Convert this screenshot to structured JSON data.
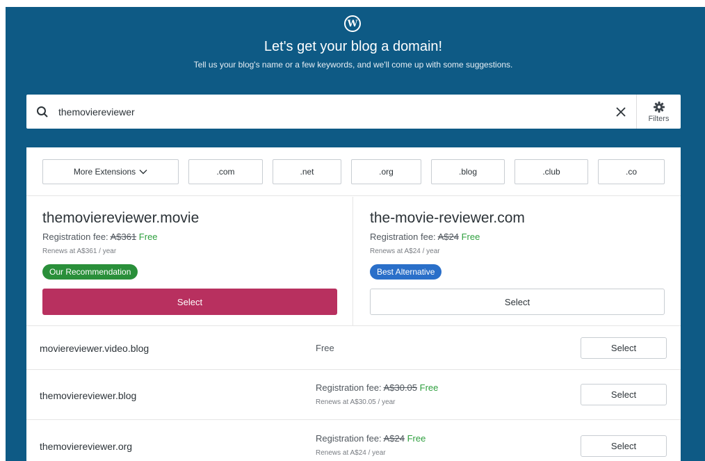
{
  "header": {
    "logo": "W",
    "title": "Let's get your blog a domain!",
    "subtitle": "Tell us your blog's name or a few keywords, and we'll come up with some suggestions."
  },
  "search": {
    "value": "themoviereviewer",
    "filters_label": "Filters"
  },
  "extensions": {
    "more_label": "More Extensions",
    "items": [
      ".com",
      ".net",
      ".org",
      ".blog",
      ".club",
      ".co"
    ]
  },
  "featured": [
    {
      "domain": "themoviereviewer.movie",
      "fee_label": "Registration fee:",
      "old_price": "A$361",
      "price": "Free",
      "renew": "Renews at A$361 / year",
      "badge": "Our Recommendation",
      "select_label": "Select"
    },
    {
      "domain": "the-movie-reviewer.com",
      "fee_label": "Registration fee:",
      "old_price": "A$24",
      "price": "Free",
      "renew": "Renews at A$24 / year",
      "badge": "Best Alternative",
      "select_label": "Select"
    }
  ],
  "results": [
    {
      "domain": "moviereviewer.video.blog",
      "price": "Free",
      "select_label": "Select"
    },
    {
      "domain": "themoviereviewer.blog",
      "fee_label": "Registration fee:",
      "old_price": "A$30.05",
      "price": "Free",
      "renew": "Renews at A$30.05 / year",
      "select_label": "Select"
    },
    {
      "domain": "themoviereviewer.org",
      "fee_label": "Registration fee:",
      "old_price": "A$24",
      "price": "Free",
      "renew": "Renews at A$24 / year",
      "select_label": "Select"
    }
  ],
  "colors": {
    "background": "#0e5a85",
    "primary_button": "#b8305f",
    "free_text": "#2e9f3e",
    "recommendation_badge": "#2a8f3a",
    "alternative_badge": "#2a6fc9"
  }
}
